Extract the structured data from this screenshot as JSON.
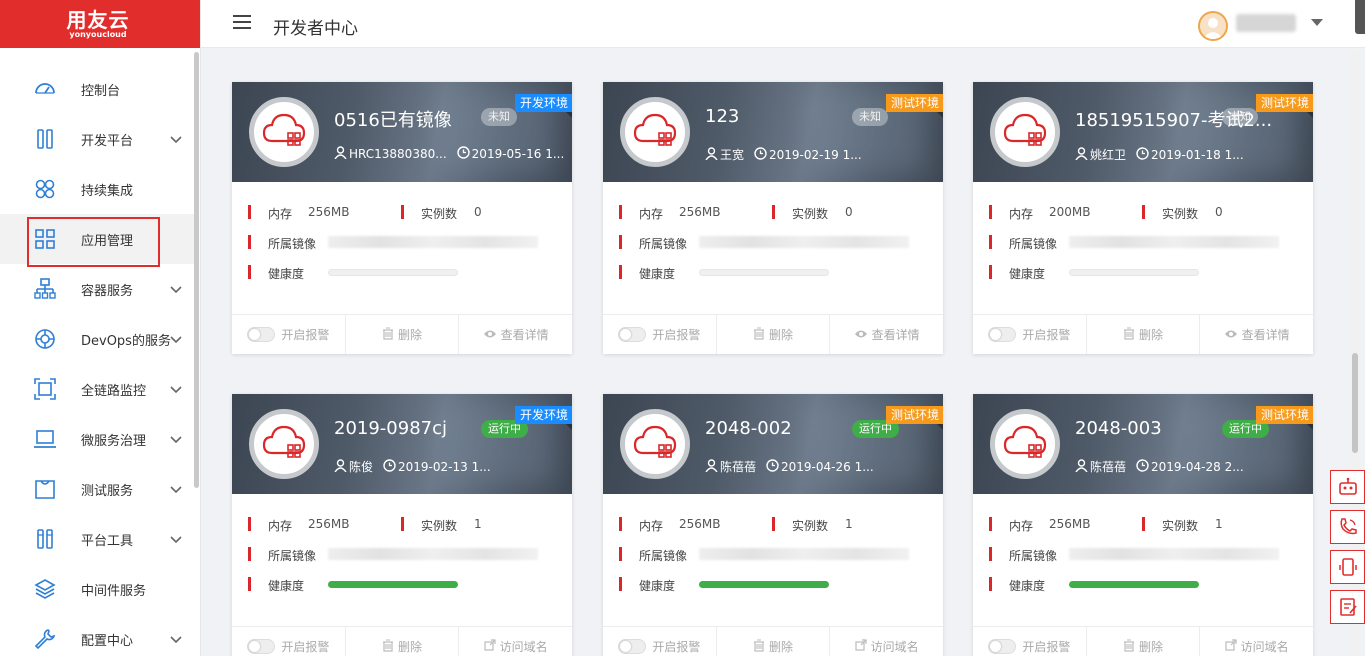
{
  "brand": {
    "logo_main": "用友云",
    "logo_sub": "yonyoucloud"
  },
  "header": {
    "title": "开发者中心"
  },
  "sidebar": {
    "items": [
      {
        "label": "控制台",
        "icon": "dashboard-icon",
        "chevron": false
      },
      {
        "label": "开发平台",
        "icon": "dev-platform-icon",
        "chevron": true
      },
      {
        "label": "持续集成",
        "icon": "integration-icon",
        "chevron": false
      },
      {
        "label": "应用管理",
        "icon": "grid-icon",
        "chevron": false,
        "active": true
      },
      {
        "label": "容器服务",
        "icon": "container-icon",
        "chevron": true
      },
      {
        "label": "DevOps的服务",
        "icon": "devops-icon",
        "chevron": true
      },
      {
        "label": "全链路监控",
        "icon": "monitor-icon",
        "chevron": true
      },
      {
        "label": "微服务治理",
        "icon": "laptop-icon",
        "chevron": true
      },
      {
        "label": "测试服务",
        "icon": "test-icon",
        "chevron": true
      },
      {
        "label": "平台工具",
        "icon": "tools-icon",
        "chevron": true
      },
      {
        "label": "中间件服务",
        "icon": "layers-icon",
        "chevron": false
      },
      {
        "label": "配置中心",
        "icon": "wrench-icon",
        "chevron": true
      }
    ]
  },
  "labels": {
    "memory": "内存",
    "instances": "实例数",
    "image": "所属镜像",
    "health": "健康度",
    "alarm": "开启报警",
    "delete": "删除",
    "detail": "查看详情",
    "domain": "访问域名"
  },
  "cards": [
    {
      "name": "0516已有镜像",
      "status": "未知",
      "status_type": "unknown",
      "env": "开发环境",
      "env_type": "dev",
      "owner": "HRC13880380...",
      "date": "2019-05-16 1...",
      "memory": "256MB",
      "instances": "0",
      "health": 0,
      "action": "查看详情"
    },
    {
      "name": "123",
      "status": "未知",
      "status_type": "unknown",
      "env": "测试环境",
      "env_type": "test",
      "owner": "王宽",
      "date": "2019-02-19 1...",
      "memory": "256MB",
      "instances": "0",
      "health": 0,
      "action": "查看详情"
    },
    {
      "name": "18519515907-考试2...",
      "status": "未知",
      "status_type": "unknown",
      "env": "测试环境",
      "env_type": "test",
      "owner": "姚红卫",
      "date": "2019-01-18 1...",
      "memory": "200MB",
      "instances": "0",
      "health": 0,
      "action": "查看详情"
    },
    {
      "name": "2019-0987cj",
      "status": "运行中",
      "status_type": "running",
      "env": "开发环境",
      "env_type": "dev",
      "owner": "陈俊",
      "date": "2019-02-13 1...",
      "memory": "256MB",
      "instances": "1",
      "health": 1,
      "action": "访问域名"
    },
    {
      "name": "2048-002",
      "status": "运行中",
      "status_type": "running",
      "env": "测试环境",
      "env_type": "test",
      "owner": "陈蓓蓓",
      "date": "2019-04-26 1...",
      "memory": "256MB",
      "instances": "1",
      "health": 1,
      "action": "访问域名"
    },
    {
      "name": "2048-003",
      "status": "运行中",
      "status_type": "running",
      "env": "测试环境",
      "env_type": "test",
      "owner": "陈蓓蓓",
      "date": "2019-04-28 2...",
      "memory": "256MB",
      "instances": "1",
      "health": 1,
      "action": "访问域名"
    }
  ],
  "colors": {
    "brand": "#e22d2d",
    "running": "#3fae49",
    "dev_env": "#1a8cff",
    "test_env": "#f79a1b"
  },
  "float_buttons": [
    "robot-icon",
    "phone-icon",
    "mobile-icon",
    "feedback-icon"
  ]
}
